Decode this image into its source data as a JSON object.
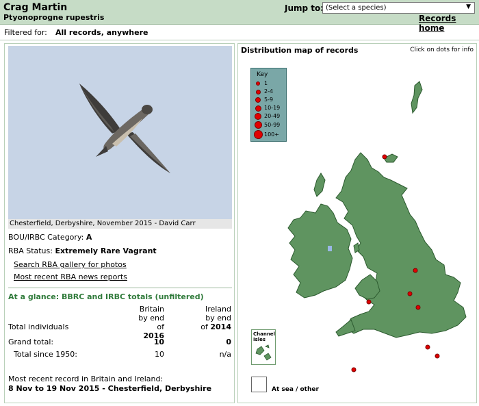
{
  "header": {
    "species_name": "Crag Martin",
    "scientific_name": "Ptyonoprogne rupestris",
    "jump_label": "Jump to:",
    "jump_select_value": "(Select a species)",
    "records_home": "Records home"
  },
  "filter": {
    "label": "Filtered for:",
    "value": "All records, anywhere"
  },
  "photo": {
    "caption": "Chesterfield, Derbyshire, November 2015 - David Carr"
  },
  "info": {
    "category_label": "BOU/IRBC Category:",
    "category_value": "A",
    "status_label": "RBA Status:",
    "status_value": "Extremely Rare Vagrant",
    "link_gallery": "Search RBA gallery for photos",
    "link_news": "Most recent RBA news reports"
  },
  "glance": {
    "title": "At a glance: BBRC and IRBC totals (unfiltered)",
    "col_britain": [
      "Britain",
      "by end",
      "of"
    ],
    "britain_year": "2016",
    "col_ireland": [
      "Ireland",
      "by end",
      "of"
    ],
    "ireland_year": "2014",
    "total_individuals_label": "Total individuals",
    "grand_total_label": "Grand total:",
    "grand_total_britain": "10",
    "grand_total_ireland": "0",
    "since_1950_label": "Total since 1950:",
    "since_1950_britain": "10",
    "since_1950_ireland": "n/a"
  },
  "recent": {
    "label": "Most recent record in Britain and Ireland:",
    "value": "8 Nov to 19 Nov 2015 - Chesterfield, Derbyshire"
  },
  "map": {
    "title": "Distribution map of records",
    "hint": "Click on dots for info",
    "key_title": "Key",
    "key_items": [
      "1",
      "2-4",
      "5-9",
      "10-19",
      "20-49",
      "50-99",
      "100+"
    ],
    "channel_isles_label": "Channel Isles",
    "at_sea_label": "At sea / other",
    "land_color": "#5f9460",
    "dot_color": "#e10000"
  }
}
